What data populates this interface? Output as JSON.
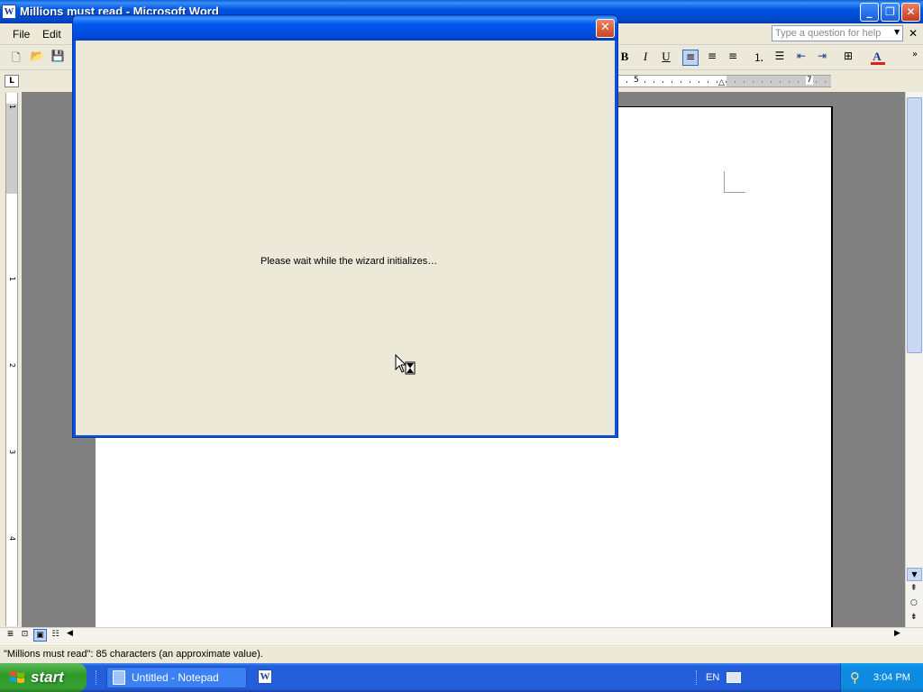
{
  "window": {
    "title": "Millions must read - Microsoft Word",
    "app_icon": "W",
    "controls": {
      "minimize": "_",
      "restore": "❐",
      "close": "✕"
    }
  },
  "menubar": {
    "file": "File",
    "edit": "Edit",
    "help_placeholder": "Type a question for help"
  },
  "toolbar": {
    "bold": "B",
    "italic": "I",
    "underline": "U",
    "font_color_letter": "A"
  },
  "ruler": {
    "h_labels": [
      "5",
      "7"
    ],
    "v_labels": [
      "1",
      "1",
      "2",
      "3",
      "4"
    ]
  },
  "dialog": {
    "message": "Please wait while the wizard initializes…",
    "close_symbol": "✕"
  },
  "statusbar": {
    "text": "\"Millions must read\": 85 characters (an approximate value)."
  },
  "taskbar": {
    "start_label": "start",
    "items": [
      {
        "label": "Untitled - Notepad"
      },
      {
        "label": "W"
      }
    ],
    "language": "EN",
    "clock": "3:04 PM"
  },
  "colors": {
    "xp_blue": "#0054e3",
    "start_green": "#36a034",
    "dialog_face": "#ece9d8",
    "close_red": "#c7441f",
    "font_color": "#e02020"
  }
}
